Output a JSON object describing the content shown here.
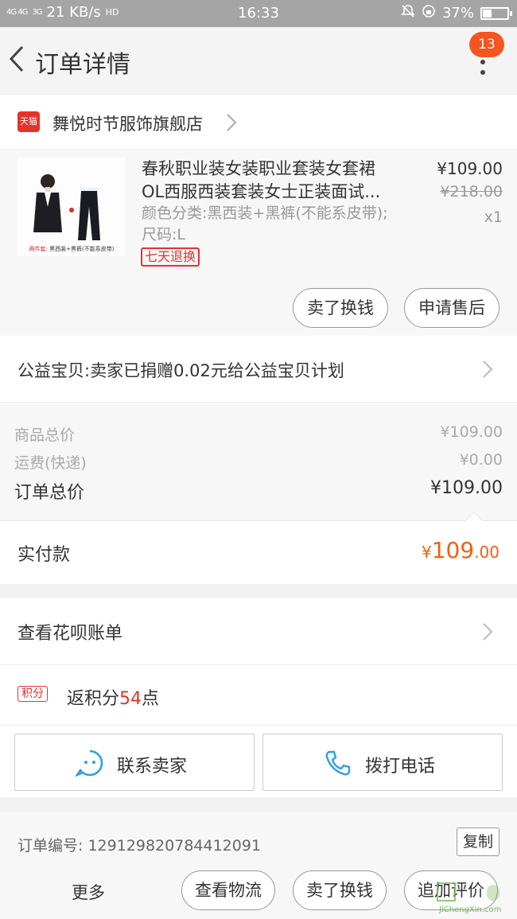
{
  "status_bar": {
    "signal_1": "4G 4G",
    "speed": "21 KB/s",
    "signal_2": "3G",
    "hd": "HD",
    "time": "16:33",
    "battery": "37%",
    "battery_level": 0.37
  },
  "header": {
    "title": "订单详情",
    "badge_count": "13"
  },
  "shop": {
    "tmall_logo": "天猫",
    "name": "舞悦时节服饰旗舰店"
  },
  "product": {
    "title": "春秋职业装女装职业套装女套裙OL西服西装套装女士正装面试...",
    "spec": "颜色分类:黑西装+黑裤(不能系皮带);尺码:L",
    "return_tag": "七天退换",
    "price": "¥109.00",
    "original_price": "¥218.00",
    "quantity": "x1",
    "thumb_caption": "两件套: 黑西装+黑裤(不能系皮带)",
    "sell_button": "卖了换钱",
    "aftersale_button": "申请售后"
  },
  "charity": {
    "text": "公益宝贝:卖家已捐赠0.02元给公益宝贝计划"
  },
  "prices": {
    "goods_label": "商品总价",
    "goods_value": "¥109.00",
    "shipping_label": "运费(快递)",
    "shipping_value": "¥0.00",
    "total_label": "订单总价",
    "total_value": "¥109.00"
  },
  "paid": {
    "label": "实付款",
    "currency": "¥",
    "integer": "109",
    "decimal": ".00"
  },
  "huabei": {
    "text": "查看花呗账单"
  },
  "points": {
    "tag": "积分",
    "prefix": "返积分",
    "number": "54",
    "suffix": "点"
  },
  "contacts": {
    "seller": "联系卖家",
    "phone": "拨打电话"
  },
  "order": {
    "label_text": "订单编号: 129129820784412091",
    "copy_button": "复制"
  },
  "bottom_bar": {
    "more": "更多",
    "logistics": "查看物流",
    "sell": "卖了换钱",
    "review": "追加评价"
  },
  "watermark": {
    "text": "JiChengXin.com"
  },
  "colors": {
    "accent_orange": "#f5600f",
    "badge": "#f5551f",
    "tmall_red": "#e5332a",
    "icon_blue": "#2fa0e8"
  }
}
